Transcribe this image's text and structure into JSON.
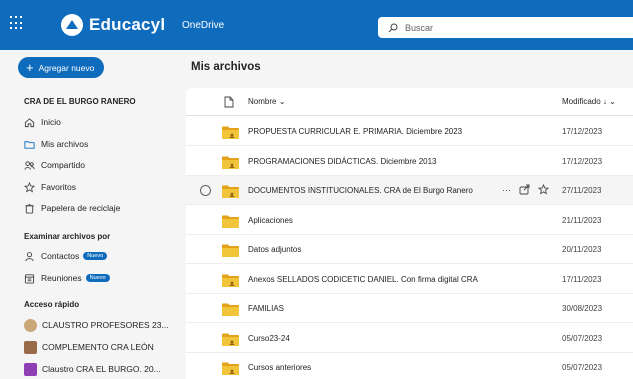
{
  "topbar": {
    "brand": "Educacyl",
    "app_name": "OneDrive",
    "search_placeholder": "Buscar"
  },
  "sidebar": {
    "new_button": "Agregar nuevo",
    "org_name": "CRA DE EL BURGO RANERO",
    "nav": [
      {
        "label": "Inicio",
        "icon": "home-icon"
      },
      {
        "label": "Mis archivos",
        "icon": "folder-icon",
        "active": true
      },
      {
        "label": "Compartido",
        "icon": "people-icon"
      },
      {
        "label": "Favoritos",
        "icon": "star-icon"
      },
      {
        "label": "Papelera de reciclaje",
        "icon": "trash-icon"
      }
    ],
    "browse_heading": "Examinar archivos por",
    "browse": [
      {
        "label": "Contactos",
        "badge": "Nuevo",
        "icon": "person-icon"
      },
      {
        "label": "Reuniones",
        "badge": "Nuevo",
        "icon": "calendar-icon"
      }
    ],
    "quick_heading": "Acceso rápido",
    "quick": [
      {
        "label": "CLAUSTRO PROFESORES 23...",
        "color": "#c9a777"
      },
      {
        "label": "COMPLEMENTO CRA LEÓN",
        "color": "#9a6b4a"
      },
      {
        "label": "Claustro CRA EL BURGO. 20...",
        "color": "#8e3fb3"
      }
    ]
  },
  "main": {
    "title": "Mis archivos",
    "col_name": "Nombre",
    "col_modified": "Modificado",
    "rows": [
      {
        "name": "PROPUESTA CURRICULAR E. PRIMARIA. Diciembre 2023",
        "date": "17/12/2023",
        "shared": true
      },
      {
        "name": "PROGRAMACIONES DIDÁCTICAS. Diciembre 2013",
        "date": "17/12/2023",
        "shared": true
      },
      {
        "name": "DOCUMENTOS INSTITUCIONALES. CRA de El Burgo Ranero",
        "date": "27/11/2023",
        "shared": true,
        "hover": true
      },
      {
        "name": "Aplicaciones",
        "date": "21/11/2023",
        "shared": false
      },
      {
        "name": "Datos adjuntos",
        "date": "20/11/2023",
        "shared": false
      },
      {
        "name": "Anexos SELLADOS CODICETIC DANIEL. Con firma digital CRA",
        "date": "17/11/2023",
        "shared": true
      },
      {
        "name": "FAMILIAS",
        "date": "30/08/2023",
        "shared": false
      },
      {
        "name": "Curso23-24",
        "date": "05/07/2023",
        "shared": true
      },
      {
        "name": "Cursos anteriores",
        "date": "05/07/2023",
        "shared": true
      }
    ]
  },
  "colors": {
    "brand": "#0f6cbd",
    "folder": "#f2c43a",
    "folder_dark": "#e3a21a"
  }
}
